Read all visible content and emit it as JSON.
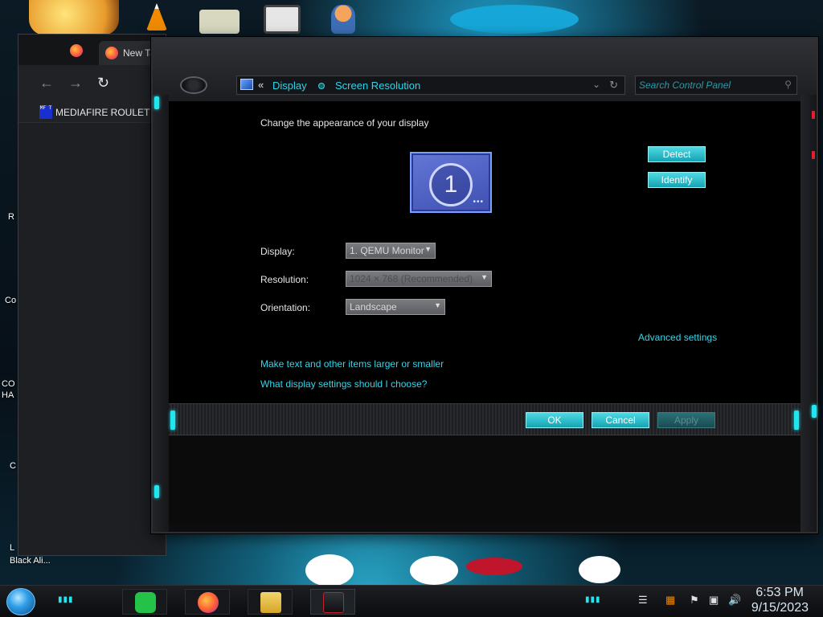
{
  "desktop": {
    "labels": [
      "R",
      "Co",
      "CO",
      "HA",
      "C",
      "L",
      "Black Ali..."
    ]
  },
  "browser": {
    "tab_title": "New Tab",
    "bookmark_icon_text": "MF T",
    "bookmark_label": "MEDIAFIRE ROULETTER"
  },
  "window": {
    "breadcrumb": [
      "Display",
      "Screen Resolution"
    ],
    "search_placeholder": "Search Control Panel",
    "heading": "Change the appearance of your display",
    "monitor_number": "1",
    "buttons": {
      "detect": "Detect",
      "identify": "Identify"
    },
    "fields": {
      "display_label": "Display:",
      "display_value": "1. QEMU Monitor",
      "resolution_label": "Resolution:",
      "resolution_value": "1024 × 768 (Recommended)",
      "orientation_label": "Orientation:",
      "orientation_value": "Landscape"
    },
    "links": {
      "advanced": "Advanced settings",
      "text_size": "Make text and other items larger or smaller",
      "which_settings": "What display settings should I choose?"
    },
    "footer": {
      "ok": "OK",
      "cancel": "Cancel",
      "apply": "Apply"
    }
  },
  "taskbar": {
    "time": "6:53 PM",
    "date": "9/15/2023"
  },
  "colors": {
    "accent_cyan": "#21e6f0",
    "link_cyan": "#33d6ea",
    "window_bg": "#000000"
  }
}
